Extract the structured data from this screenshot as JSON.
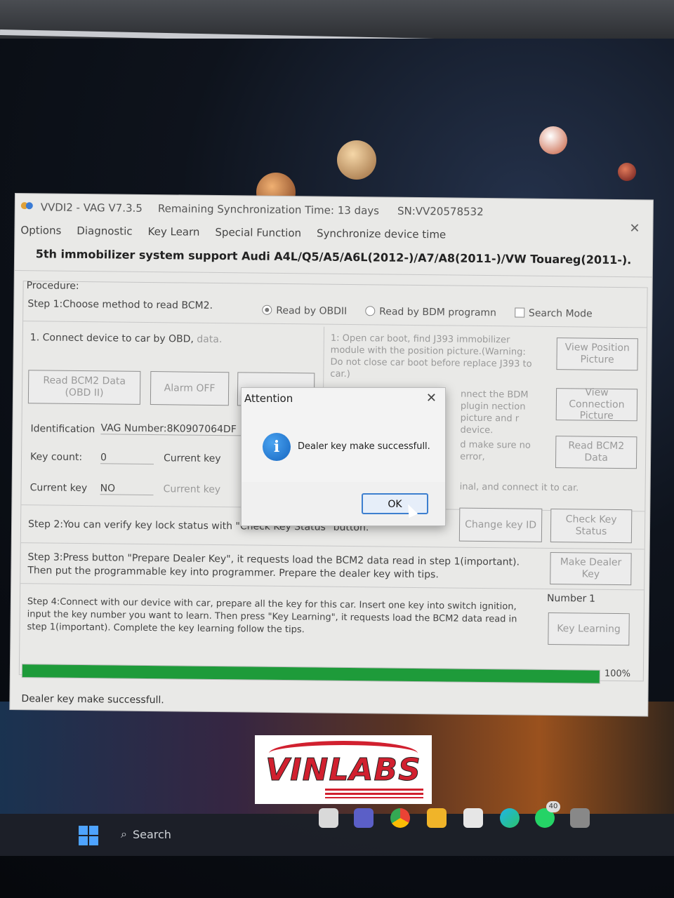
{
  "window": {
    "title": "VVDI2 - VAG V7.3.5",
    "sync_time": "Remaining Synchronization Time: 13 days",
    "serial": "SN:VV20578532"
  },
  "menu": [
    "Options",
    "Diagnostic",
    "Key Learn",
    "Special Function",
    "Synchronize device time"
  ],
  "headline": "5th immobilizer system support Audi A4L/Q5/A5/A6L(2012-)/A7/A8(2011-)/VW Touareg(2011-).",
  "procedure": {
    "title": "Procedure:",
    "step1": "Step 1:Choose method to read BCM2.",
    "radio_obdii": "Read by OBDII",
    "radio_bdm": "Read by BDM programn",
    "search_mode": "Search Mode",
    "connect_text": "1. Connect device to car by OBD,",
    "connect_text_tail": "data.",
    "btn_read_bcm2_obd": "Read BCM2 Data (OBD II)",
    "btn_alarm_off": "Alarm OFF",
    "identification_label": "Identification",
    "identification_value": "VAG Number:8K0907064DF",
    "key_count_label": "Key count:",
    "key_count_value": "0",
    "current_key_label": "Current key",
    "current_key_label2": "Current key",
    "current_key_value": "NO",
    "current_key_label3": "Current key",
    "bdm_step1": "1: Open car boot, find J393 immobilizer module with the position picture.(Warning: Do not close car boot before replace J393 to car.)",
    "btn_view_position": "View Position Picture",
    "bdm_step2": "nnect the BDM plugin nection picture and r device.",
    "btn_view_connection": "View Connection Picture",
    "bdm_step3": "d make sure no error,",
    "btn_read_bcm2_data": "Read BCM2 Data",
    "bdm_step4": "inal, and connect it to car.",
    "step2": "Step 2:You can verify key lock status with \"Check Key Status\" button.",
    "btn_change_key_id": "Change key ID",
    "btn_check_key_status": "Check Key Status",
    "step3": "Step 3:Press button \"Prepare Dealer Key\", it requests load the BCM2 data read in step 1(important). Then put the programmable key into programmer. Prepare the dealer key with tips.",
    "btn_make_dealer_key": "Make Dealer Key",
    "step4": "Step 4:Connect with our device with car, prepare all the key for this car. Insert one key into switch ignition, input the key number you want to learn. Then press \"Key Learning\", it requests load the BCM2 data read in step 1(important). Complete the key learning follow the tips.",
    "number_label": "Number",
    "number_value": "1",
    "btn_key_learning": "Key Learning",
    "progress": 1.0,
    "progress_label": "100%"
  },
  "status_bar": "Dealer key make successfull.",
  "dialog": {
    "title": "Attention",
    "icon": "info-icon",
    "message": "Dealer key make successfull.",
    "ok": "OK"
  },
  "watermark": "VINLABS",
  "taskbar": {
    "search": "Search",
    "notification_count": "40"
  },
  "colors": {
    "progress": "#1e9b3a",
    "dialog_button_border": "#3d7fcf",
    "watermark": "#d1202f"
  }
}
